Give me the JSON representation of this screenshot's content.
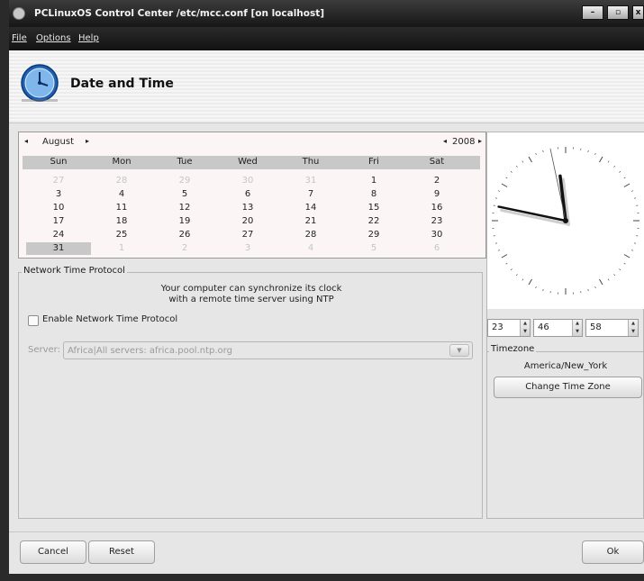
{
  "window": {
    "title": "PCLinuxOS Control Center /etc/mcc.conf [on localhost]",
    "controls": {
      "minimize": "–",
      "maximize": "▫",
      "close": "x"
    }
  },
  "menubar": [
    "File",
    "Options",
    "Help"
  ],
  "header": {
    "title": "Date and Time",
    "icon": "clock-icon"
  },
  "calendar": {
    "month": "August",
    "year": "2008",
    "prev_month": "◂",
    "next_month": "▸",
    "prev_year": "◂",
    "next_year": "▸",
    "weekdays": [
      "Sun",
      "Mon",
      "Tue",
      "Wed",
      "Thu",
      "Fri",
      "Sat"
    ],
    "weeks": [
      [
        "27",
        "28",
        "29",
        "30",
        "31",
        "1",
        "2"
      ],
      [
        "3",
        "4",
        "5",
        "6",
        "7",
        "8",
        "9"
      ],
      [
        "10",
        "11",
        "12",
        "13",
        "14",
        "15",
        "16"
      ],
      [
        "17",
        "18",
        "19",
        "20",
        "21",
        "22",
        "23"
      ],
      [
        "24",
        "25",
        "26",
        "27",
        "28",
        "29",
        "30"
      ],
      [
        "31",
        "1",
        "2",
        "3",
        "4",
        "5",
        "6"
      ]
    ],
    "selected_day": "31"
  },
  "ntp": {
    "group_title": "Network Time Protocol",
    "description_line1": "Your computer can synchronize its clock",
    "description_line2": "with a remote time server using NTP",
    "enable_label": "Enable Network Time Protocol",
    "enabled": false,
    "server_label": "Server:",
    "server_value": "Africa|All servers: africa.pool.ntp.org"
  },
  "clock": {
    "hours": 23,
    "minutes": 46,
    "seconds": 58
  },
  "time_fields": {
    "hour": "23",
    "minute": "46",
    "second": "58"
  },
  "timezone": {
    "group_title": "Timezone",
    "value": "America/New_York",
    "change_button": "Change Time Zone"
  },
  "buttons": {
    "cancel": "Cancel",
    "reset": "Reset",
    "ok": "Ok"
  },
  "colors": {
    "titlebar": "#1e1e1e",
    "window_bg": "#e6e6e6",
    "calendar_bg": "#fbf5f5",
    "selected_day": "#c8c8c8"
  }
}
